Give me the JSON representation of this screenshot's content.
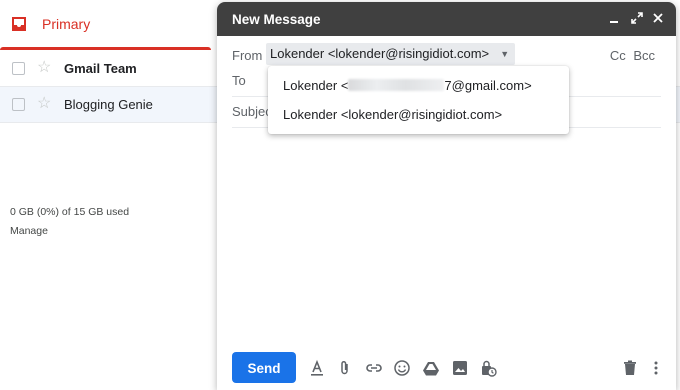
{
  "inbox": {
    "primary_tab_label": "Primary",
    "rows": [
      {
        "sender": "Gmail Team"
      },
      {
        "sender": "Blogging Genie"
      }
    ],
    "storage_text": "0 GB (0%) of 15 GB used",
    "manage_label": "Manage"
  },
  "compose": {
    "title": "New Message",
    "header_icons": [
      "minimize-icon",
      "expand-icon",
      "close-icon"
    ],
    "from_label": "From",
    "from_value": "Lokender <lokender@risingidiot.com>",
    "cc_label": "Cc",
    "bcc_label": "Bcc",
    "to_label": "To",
    "subject_label": "Subject",
    "dropdown": {
      "option1_prefix": "Lokender <",
      "option1_suffix": "7@gmail.com>",
      "option2": "Lokender <lokender@risingidiot.com>"
    },
    "send_label": "Send",
    "toolbar_icons": [
      "format-text-icon",
      "attach-icon",
      "link-icon",
      "emoji-icon",
      "drive-icon",
      "photo-icon",
      "confidential-icon",
      "trash-icon",
      "more-icon"
    ]
  },
  "colors": {
    "accent_red": "#d93025",
    "header_bg": "#404040",
    "send_blue": "#1a73e8"
  }
}
